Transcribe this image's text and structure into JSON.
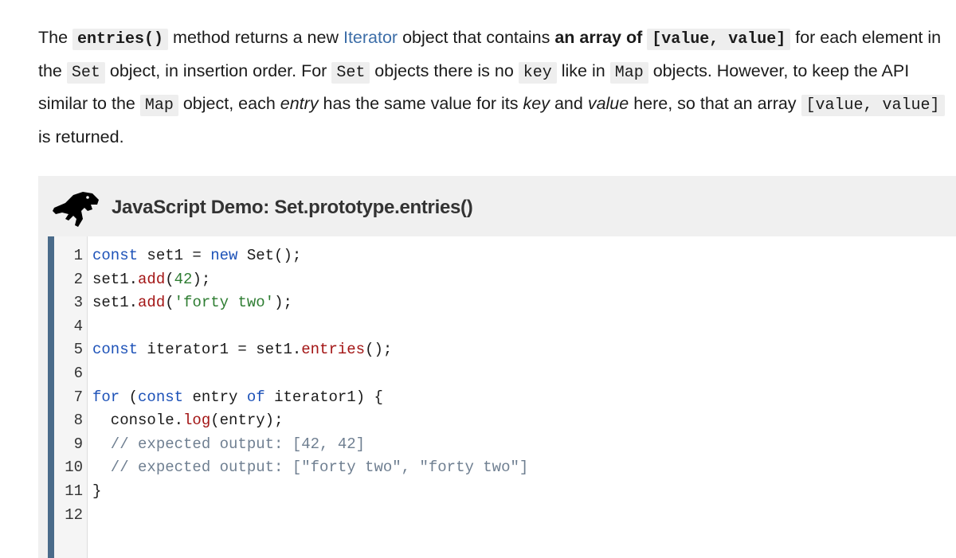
{
  "intro": {
    "t1": "The ",
    "entries_code": "entries()",
    "t2": " method returns a new ",
    "iterator_link": "Iterator",
    "t3": " object that contains ",
    "bold_text": "an array of ",
    "value_value_code": "[value, value]",
    "t4": " for each element in the ",
    "set_code_1": "Set",
    "t5": " object, in insertion order. For ",
    "set_code_2": "Set",
    "t6": " objects there is no ",
    "key_code": "key",
    "t7": " like in ",
    "map_code_1": "Map",
    "t8": " objects. However, to keep the API similar to the ",
    "map_code_2": "Map",
    "t9": " object, each ",
    "entry_em": "entry",
    "t10": " has the same value for its ",
    "key_em": "key",
    "t11": " and ",
    "value_em": "value",
    "t12": " here, so that an array ",
    "value_value_code_2": "[value, value]",
    "t13": " is returned."
  },
  "demo": {
    "logo_icon": "dinosaur-icon",
    "title": "JavaScript Demo: Set.prototype.entries()",
    "line_numbers": [
      "1",
      "2",
      "3",
      "4",
      "5",
      "6",
      "7",
      "8",
      "9",
      "10",
      "11",
      "12"
    ],
    "code": {
      "l1": [
        "const",
        " set1 = ",
        "new",
        " Set();"
      ],
      "l2": [
        "set1.",
        "add",
        "(",
        "42",
        ");"
      ],
      "l3": [
        "set1.",
        "add",
        "(",
        "'forty two'",
        ");"
      ],
      "l5": [
        "const",
        " iterator1 = set1.",
        "entries",
        "();"
      ],
      "l7": [
        "for",
        " (",
        "const",
        " entry ",
        "of",
        " iterator1) {"
      ],
      "l8": [
        "  console.",
        "log",
        "(entry);"
      ],
      "l9": "  // expected output: [42, 42]",
      "l10": "  // expected output: [\"forty two\", \"forty two\"]",
      "l11": "}"
    }
  },
  "colors": {
    "keyword": "#1d52b8",
    "method": "#a31515",
    "literal": "#2e7d32",
    "comment": "#6f7f91",
    "editor_border": "#4a6b8a",
    "link": "#3d6ea8"
  }
}
